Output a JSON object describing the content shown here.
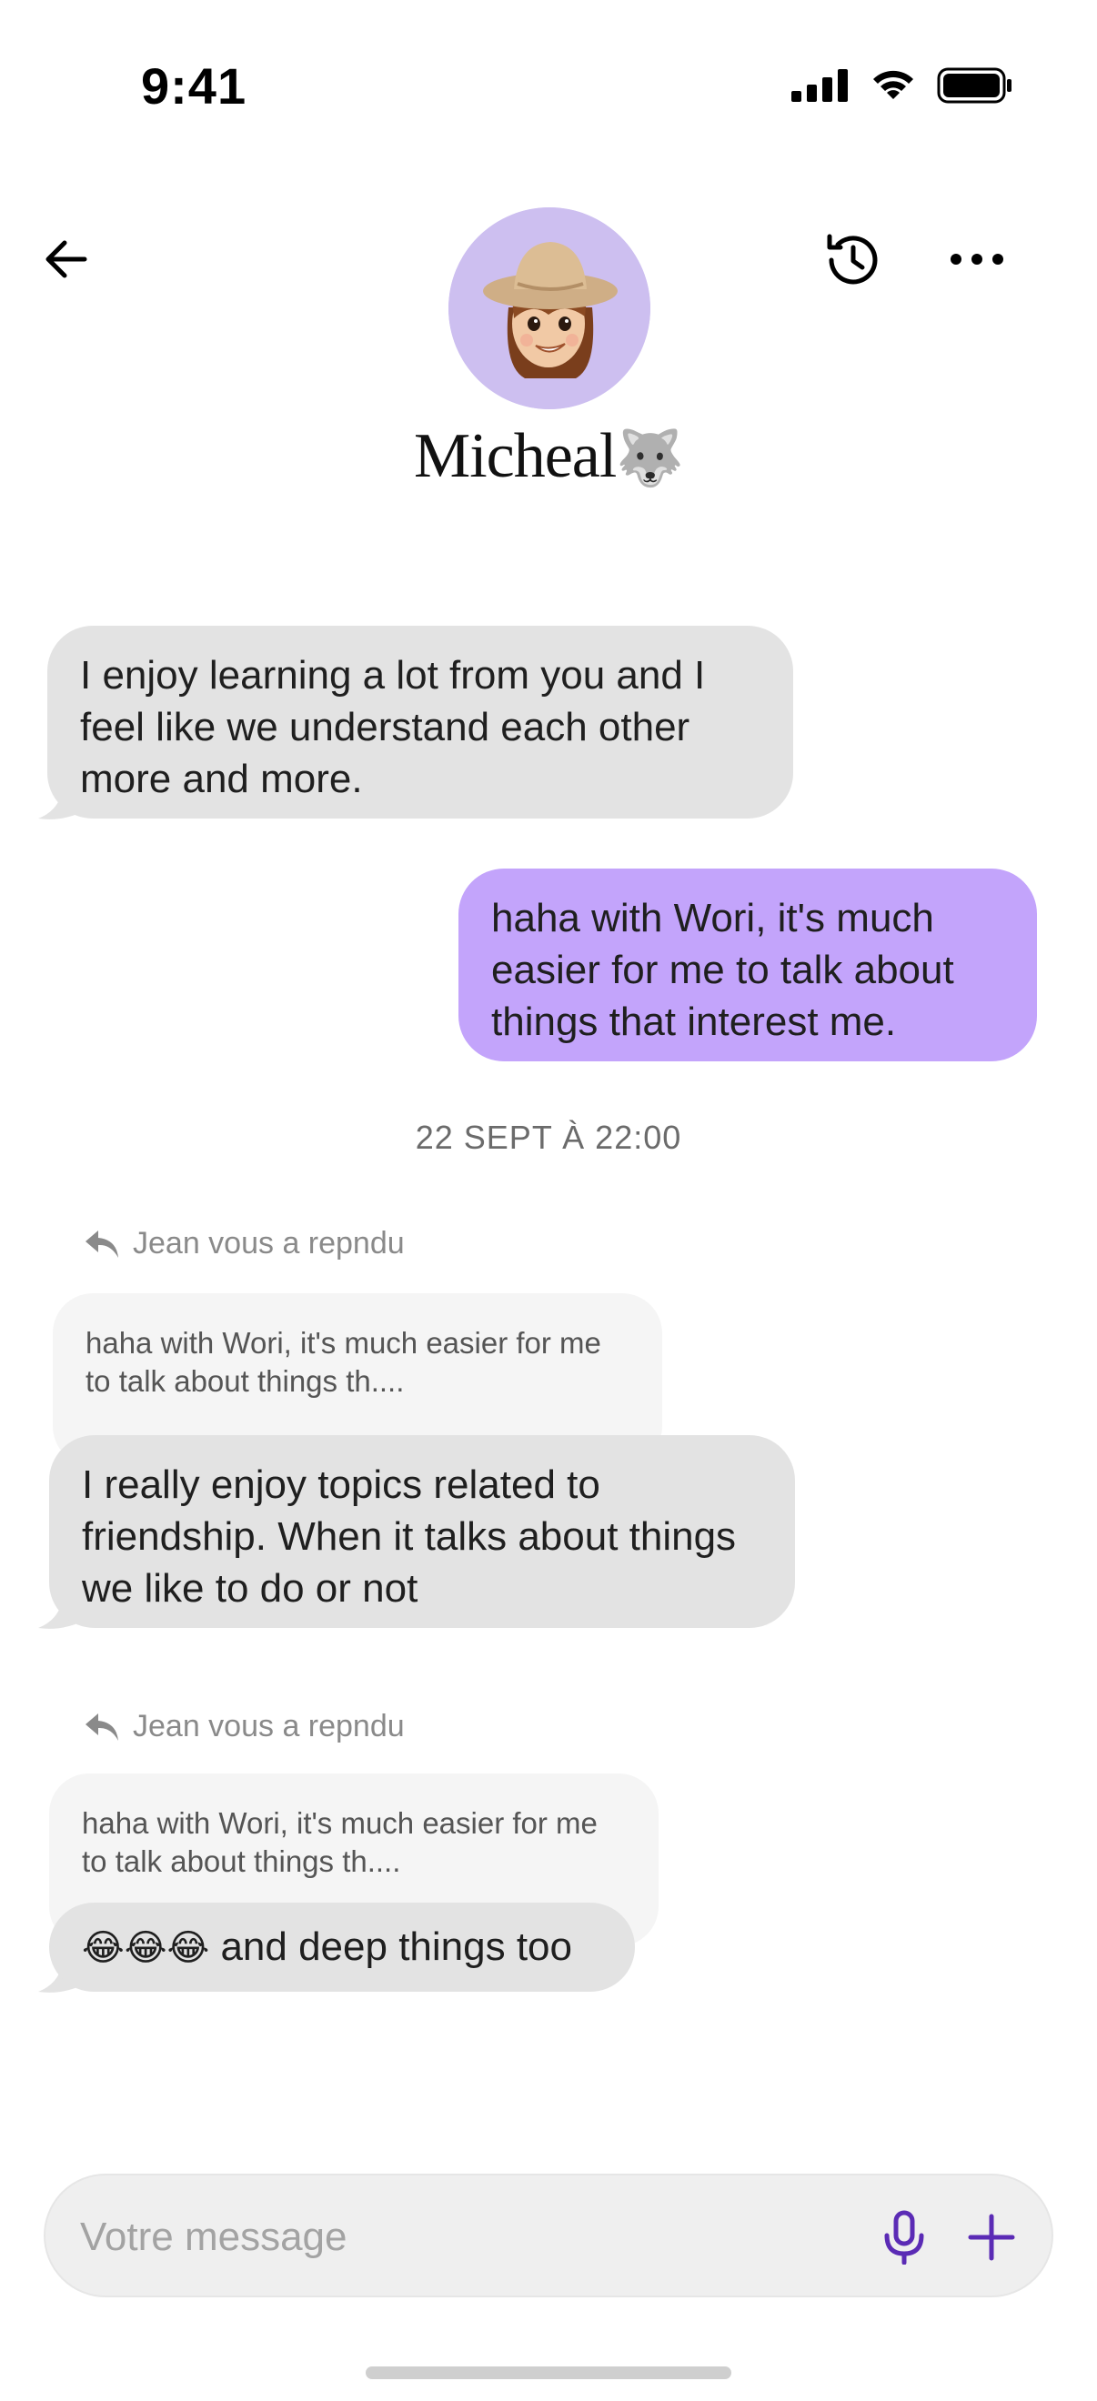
{
  "status_bar": {
    "time": "9:41",
    "icons": [
      "cellular-signal-icon",
      "wifi-icon",
      "battery-icon"
    ]
  },
  "header": {
    "contact_name": "Micheal",
    "name_emoji": "🐺",
    "back_icon": "arrow-left-icon",
    "history_icon": "history-icon",
    "more_icon": "more-horizontal-icon",
    "avatar_bg": "#cdbff0"
  },
  "messages": {
    "msg1": "I enjoy learning a lot from you and I feel like we understand each other more and more.",
    "msg2": "haha with Wori, it's much easier for me to talk about things that interest me.",
    "timestamp": "22 SEPT À 22:00",
    "reply1": {
      "label": "Jean vous a repndu",
      "quote": "haha with Wori, it's much easier for me to talk about things th....",
      "text": "I really enjoy topics related to friendship. When it talks about things we like to do or not"
    },
    "reply2": {
      "label": "Jean vous a repndu",
      "quote": "haha with Wori, it's much easier for me to talk about things th....",
      "emojis": "😂😂😂",
      "text": " and deep things too"
    }
  },
  "composer": {
    "placeholder": "Votre message",
    "mic_icon": "microphone-icon",
    "plus_icon": "plus-icon"
  },
  "colors": {
    "incoming_bubble": "#e3e3e3",
    "outgoing_bubble": "#c3a4fb",
    "quote_bubble": "#f5f5f5",
    "accent": "#5b2bb5"
  }
}
